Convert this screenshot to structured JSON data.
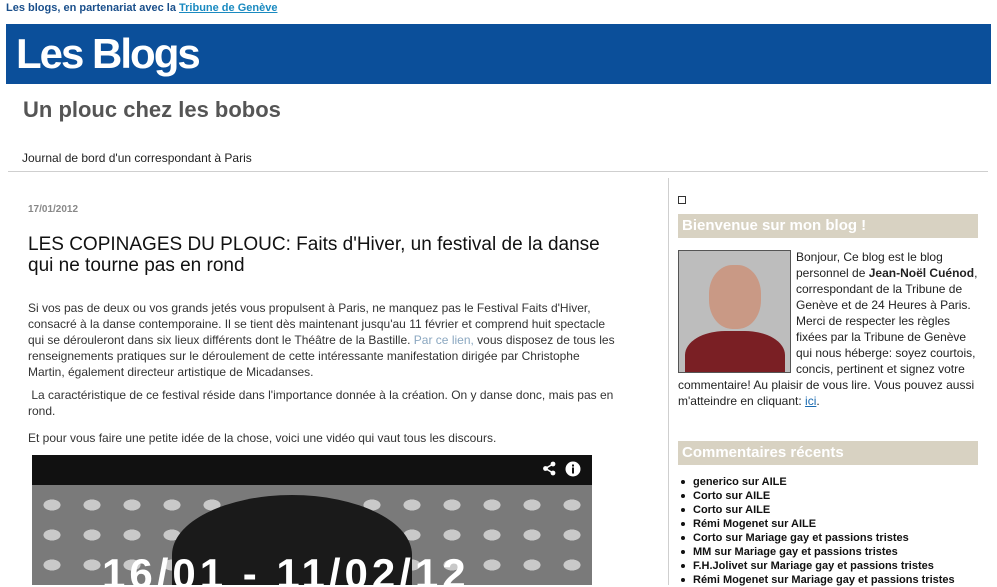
{
  "topbar": {
    "prefix": "Les blogs, en partenariat avec la",
    "link": "Tribune de Genève"
  },
  "banner": {
    "logo": "Les Blogs",
    "color": "#0b4f9a"
  },
  "blog": {
    "title": "Un plouc chez les bobos",
    "description": "Journal de bord d'un correspondant à Paris"
  },
  "post": {
    "date": "17/01/2012",
    "title": "LES COPINAGES DU PLOUC: Faits d'Hiver, un festival de la danse qui ne tourne pas en rond",
    "para1_start": "Si vos pas de deux ou vos grands jetés vous propulsent à Paris, ne manquez pas le Festival Faits d'Hiver, consacré à la danse contemporaine. Il se tient dès maintenant jusqu'au 11 février et comprend huit spectacle qui se dérouleront dans six lieux différents dont le Théâtre de la Bastille.",
    "para1_link": "Par ce lien,",
    "para1_end": "vous disposez de tous les renseignements pratiques sur le déroulement de cette intéressante manifestation dirigée par Christophe Martin, également directeur artistique de Micadanses.",
    "para2": "La caractéristique de ce festival réside dans l'importance donnée à la création. On y danse donc, mais pas en rond.",
    "para3": "Et pour vous faire une petite idée de la chose, voici une vidéo qui vaut tous les discours.",
    "video_text": "16/01 - 11/02/12"
  },
  "sidebar": {
    "welcome_title": "Bienvenue sur mon blog !",
    "welcome_start": "Bonjour, Ce blog est le blog personnel de",
    "welcome_name": "Jean-Noël Cuénod",
    "welcome_mid": ", correspondant de la Tribune de Genève et de 24 Heures à Paris. Merci de respecter les règles fixées par la Tribune de Genève qui nous héberge: soyez courtois, concis, pertinent et signez votre commentaire! Au plaisir de vous lire. Vous pouvez aussi m'atteindre en cliquant:",
    "welcome_link": "ici",
    "welcome_end": ".",
    "comments_title": "Commentaires récents",
    "comments": [
      "generico sur AILE",
      "Corto sur AILE",
      "Corto sur AILE",
      "Rémi Mogenet sur AILE",
      "Corto sur Mariage gay et passions tristes",
      "MM sur Mariage gay et passions tristes",
      "F.H.Jolivet sur Mariage gay et passions tristes",
      "Rémi Mogenet sur Mariage gay et passions tristes"
    ]
  },
  "icons": {
    "share": "share-icon",
    "info": "info-icon"
  }
}
